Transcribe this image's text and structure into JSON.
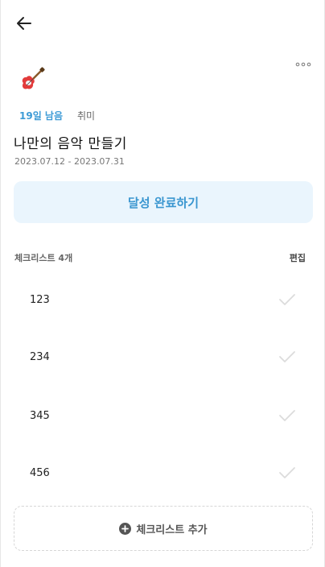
{
  "header": {
    "back_icon": "arrow-left-icon",
    "more_icon": "more-dots-icon"
  },
  "goal": {
    "icon": "guitar-icon",
    "days_left": "19일 남음",
    "category": "취미",
    "title": "나만의 음악 만들기",
    "period": "2023.07.12 - 2023.07.31",
    "complete_label": "달성 완료하기",
    "accent_color": "#3a96d0"
  },
  "checklist": {
    "title": "체크리스트 4개",
    "edit_label": "편집",
    "items": [
      {
        "label": "123",
        "checked": false
      },
      {
        "label": "234",
        "checked": false
      },
      {
        "label": "345",
        "checked": false
      },
      {
        "label": "456",
        "checked": false
      }
    ],
    "add_label": "체크리스트 추가",
    "add_icon": "plus-circle-icon"
  }
}
